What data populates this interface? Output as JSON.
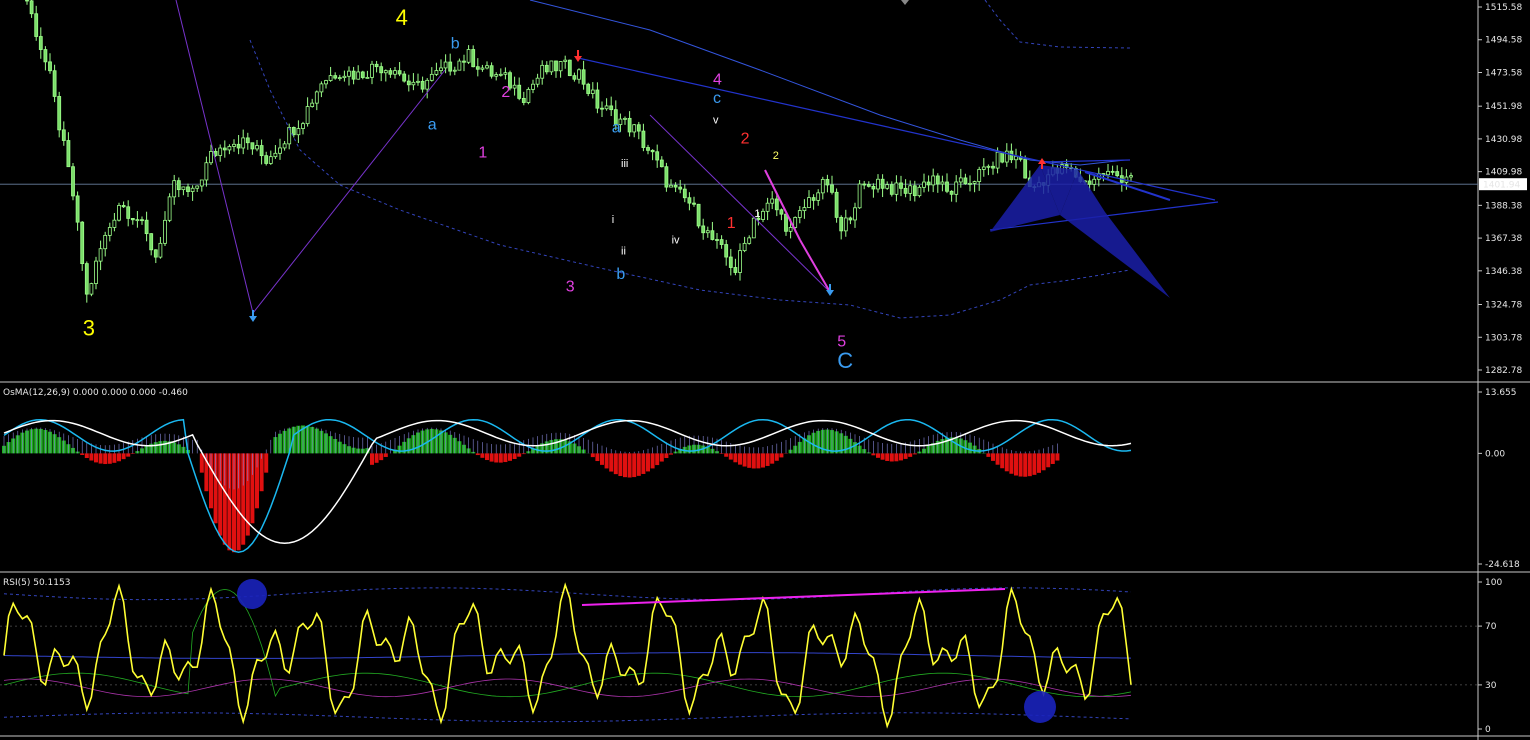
{
  "colors": {
    "background": "#000000",
    "candle_up": "#9dff8a",
    "candle_down": "#7bdc6a",
    "trend_blue": "#2233cc",
    "band_blue": "#3344bb",
    "pattern_fill": "#1a1fa8",
    "osma_green": "#1fae1f",
    "osma_red": "#e01010",
    "macd_white": "#ffffff",
    "macd_cyan": "#1ab8f0",
    "rsi_yellow": "#ffff33",
    "wave_yellow": "#ffff00",
    "wave_magenta": "#e040e0",
    "wave_blue": "#3a9bf0",
    "wave_red": "#ff3030"
  },
  "chart_data": [
    {
      "type": "candlestick",
      "pane": "price",
      "ylim": [
        1282.78,
        1515.58
      ],
      "yticks": [
        "1515.58",
        "1494.58",
        "1473.58",
        "1451.98",
        "1430.98",
        "1409.98",
        "1388.38",
        "1367.38",
        "1346.38",
        "1324.78",
        "1303.78",
        "1282.78"
      ],
      "current_price": "1401.94",
      "close_path": [
        [
          0,
          1560
        ],
        [
          5,
          1520
        ],
        [
          10,
          1470
        ],
        [
          15,
          1395
        ],
        [
          18,
          1330
        ],
        [
          21,
          1360
        ],
        [
          25,
          1390
        ],
        [
          29,
          1380
        ],
        [
          33,
          1356
        ],
        [
          37,
          1400
        ],
        [
          41,
          1395
        ],
        [
          45,
          1420
        ],
        [
          49,
          1430
        ],
        [
          53,
          1428
        ],
        [
          57,
          1418
        ],
        [
          61,
          1432
        ],
        [
          65,
          1445
        ],
        [
          69,
          1468
        ],
        [
          73,
          1475
        ],
        [
          77,
          1472
        ],
        [
          81,
          1478
        ],
        [
          85,
          1476
        ],
        [
          89,
          1463
        ],
        [
          93,
          1470
        ],
        [
          97,
          1478
        ],
        [
          101,
          1484
        ],
        [
          105,
          1474
        ],
        [
          109,
          1469
        ],
        [
          113,
          1459
        ],
        [
          117,
          1474
        ],
        [
          121,
          1478
        ],
        [
          125,
          1473
        ],
        [
          129,
          1453
        ],
        [
          133,
          1445
        ],
        [
          137,
          1437
        ],
        [
          141,
          1420
        ],
        [
          145,
          1399
        ],
        [
          149,
          1390
        ],
        [
          153,
          1370
        ],
        [
          157,
          1355
        ],
        [
          159,
          1347
        ],
        [
          163,
          1380
        ],
        [
          167,
          1390
        ],
        [
          171,
          1372
        ],
        [
          175,
          1392
        ],
        [
          179,
          1403
        ],
        [
          182,
          1370
        ],
        [
          186,
          1398
        ],
        [
          190,
          1404
        ],
        [
          194,
          1398
        ],
        [
          198,
          1398
        ],
        [
          202,
          1407
        ],
        [
          205,
          1396
        ],
        [
          209,
          1403
        ],
        [
          213,
          1410
        ],
        [
          217,
          1420
        ],
        [
          221,
          1418
        ],
        [
          223,
          1398
        ],
        [
          227,
          1408
        ],
        [
          231,
          1412
        ],
        [
          235,
          1403
        ],
        [
          239,
          1409
        ],
        [
          243,
          1407
        ],
        [
          245,
          1409
        ]
      ],
      "n_bars": 246
    },
    {
      "type": "histogram+lines",
      "pane": "osma",
      "title": "OsMA(12,26,9) 0.000 0.000 0.000 -0.460",
      "ylim": [
        -24.618,
        13.655
      ],
      "yticks": [
        "13.655",
        "0.00",
        "-24.618"
      ]
    },
    {
      "type": "line",
      "pane": "rsi",
      "title": "RSI(5) 50.1153",
      "ylim": [
        0,
        100
      ],
      "yticks": [
        "100",
        "70",
        "30",
        "0"
      ],
      "levels": [
        30,
        70
      ]
    }
  ],
  "wave_labels": [
    {
      "text": "3",
      "color": "wave_yellow",
      "size": "big",
      "bar": 18,
      "price": 1305
    },
    {
      "text": "4",
      "color": "wave_yellow",
      "size": "big",
      "bar": 86,
      "price": 1504
    },
    {
      "text": "a",
      "color": "wave_blue",
      "size": "mid",
      "bar": 93,
      "price": 1437
    },
    {
      "text": "b",
      "color": "wave_blue",
      "size": "mid",
      "bar": 98,
      "price": 1489
    },
    {
      "text": "1",
      "color": "wave_magenta",
      "size": "mid",
      "bar": 104,
      "price": 1419
    },
    {
      "text": "2",
      "color": "wave_magenta",
      "size": "mid",
      "bar": 109,
      "price": 1458
    },
    {
      "text": "3",
      "color": "wave_magenta",
      "size": "mid",
      "bar": 123,
      "price": 1333
    },
    {
      "text": "a",
      "color": "wave_blue",
      "size": "mid",
      "bar": 133,
      "price": 1435
    },
    {
      "text": "b",
      "color": "wave_blue",
      "size": "mid",
      "bar": 134,
      "price": 1341
    },
    {
      "text": "iii",
      "color": "#ffffff",
      "size": "small",
      "bar": 135,
      "price": 1413
    },
    {
      "text": "i",
      "color": "#ffffff",
      "size": "small",
      "bar": 133,
      "price": 1377
    },
    {
      "text": "ii",
      "color": "#ffffff",
      "size": "small",
      "bar": 135,
      "price": 1357
    },
    {
      "text": "iv",
      "color": "#ffffff",
      "size": "small",
      "bar": 146,
      "price": 1364
    },
    {
      "text": "4",
      "color": "wave_magenta",
      "size": "mid",
      "bar": 155,
      "price": 1466
    },
    {
      "text": "c",
      "color": "wave_blue",
      "size": "mid",
      "bar": 155,
      "price": 1454
    },
    {
      "text": "v",
      "color": "#ffffff",
      "size": "small",
      "bar": 155,
      "price": 1441
    },
    {
      "text": "2",
      "color": "wave_red",
      "size": "mid",
      "bar": 161,
      "price": 1428
    },
    {
      "text": "1",
      "color": "wave_red",
      "size": "mid",
      "bar": 158,
      "price": 1374
    },
    {
      "text": "1",
      "color": "#ffffff",
      "size": "small",
      "bar": 164,
      "price": 1381
    },
    {
      "text": "2",
      "color": "#ffff66",
      "size": "small",
      "bar": 168,
      "price": 1418
    },
    {
      "text": "5",
      "color": "wave_magenta",
      "size": "mid",
      "bar": 182,
      "price": 1298
    },
    {
      "text": "C",
      "color": "wave_blue",
      "size": "big",
      "bar": 182,
      "price": 1284
    }
  ]
}
